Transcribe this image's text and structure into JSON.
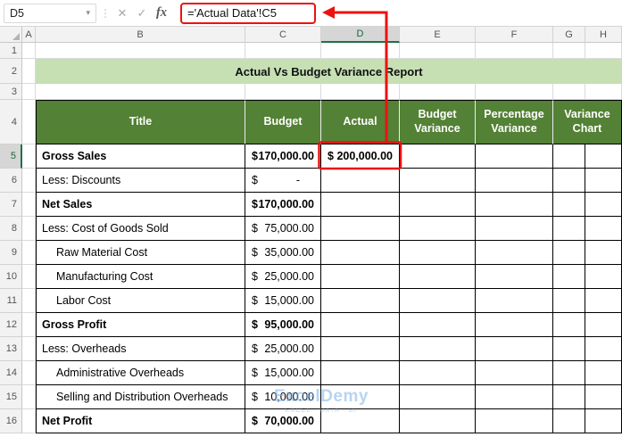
{
  "formula_bar": {
    "cell_reference": "D5",
    "formula": "='Actual Data'!C5",
    "cancel_label": "✕",
    "enter_label": "✓",
    "fx_label": "fx"
  },
  "sheet": {
    "column_letters": [
      "A",
      "B",
      "C",
      "D",
      "E",
      "F",
      "G",
      "H"
    ],
    "selected_column": "D",
    "selected_row": 5,
    "row_count": 16,
    "title": "Actual Vs Budget Variance Report",
    "table": {
      "headers": {
        "title": "Title",
        "budget": "Budget",
        "actual": "Actual",
        "budget_variance": "Budget Variance",
        "percentage_variance": "Percentage Variance",
        "variance_chart": "Variance Chart"
      },
      "empty_columns": [
        "E",
        "F",
        "G",
        "H"
      ],
      "rows": [
        {
          "row": 5,
          "label": "Gross Sales",
          "bold": true,
          "indent": false,
          "budget": {
            "currency": "$",
            "amount": "170,000.00"
          },
          "actual": {
            "currency": "$",
            "amount": "200,000.00"
          },
          "highlighted": true
        },
        {
          "row": 6,
          "label": "Less: Discounts",
          "bold": false,
          "indent": false,
          "budget": {
            "currency": "$",
            "amount": "-"
          }
        },
        {
          "row": 7,
          "label": "Net Sales",
          "bold": true,
          "indent": false,
          "budget": {
            "currency": "$",
            "amount": "170,000.00"
          }
        },
        {
          "row": 8,
          "label": "Less: Cost of Goods Sold",
          "bold": false,
          "indent": false,
          "budget": {
            "currency": "$",
            "amount": "75,000.00"
          }
        },
        {
          "row": 9,
          "label": "Raw Material Cost",
          "bold": false,
          "indent": true,
          "budget": {
            "currency": "$",
            "amount": "35,000.00"
          }
        },
        {
          "row": 10,
          "label": "Manufacturing Cost",
          "bold": false,
          "indent": true,
          "budget": {
            "currency": "$",
            "amount": "25,000.00"
          }
        },
        {
          "row": 11,
          "label": "Labor Cost",
          "bold": false,
          "indent": true,
          "budget": {
            "currency": "$",
            "amount": "15,000.00"
          }
        },
        {
          "row": 12,
          "label": "Gross Profit",
          "bold": true,
          "indent": false,
          "budget": {
            "currency": "$",
            "amount": "95,000.00"
          }
        },
        {
          "row": 13,
          "label": "Less: Overheads",
          "bold": false,
          "indent": false,
          "budget": {
            "currency": "$",
            "amount": "25,000.00"
          }
        },
        {
          "row": 14,
          "label": "Administrative Overheads",
          "bold": false,
          "indent": true,
          "budget": {
            "currency": "$",
            "amount": "15,000.00"
          }
        },
        {
          "row": 15,
          "label": "Selling and Distribution Overheads",
          "bold": false,
          "indent": true,
          "budget": {
            "currency": "$",
            "amount": "10,000.00"
          }
        },
        {
          "row": 16,
          "label": "Net Profit",
          "bold": true,
          "indent": false,
          "budget": {
            "currency": "$",
            "amount": "70,000.00"
          }
        }
      ]
    },
    "watermark": {
      "line1": "ExcelDemy",
      "line2": "EXCEL · DATA - BI"
    }
  },
  "colors": {
    "header_green": "#538135",
    "title_green": "#C6E0B4",
    "selection_green": "#1E7145",
    "annotation_red": "#ED1111"
  }
}
